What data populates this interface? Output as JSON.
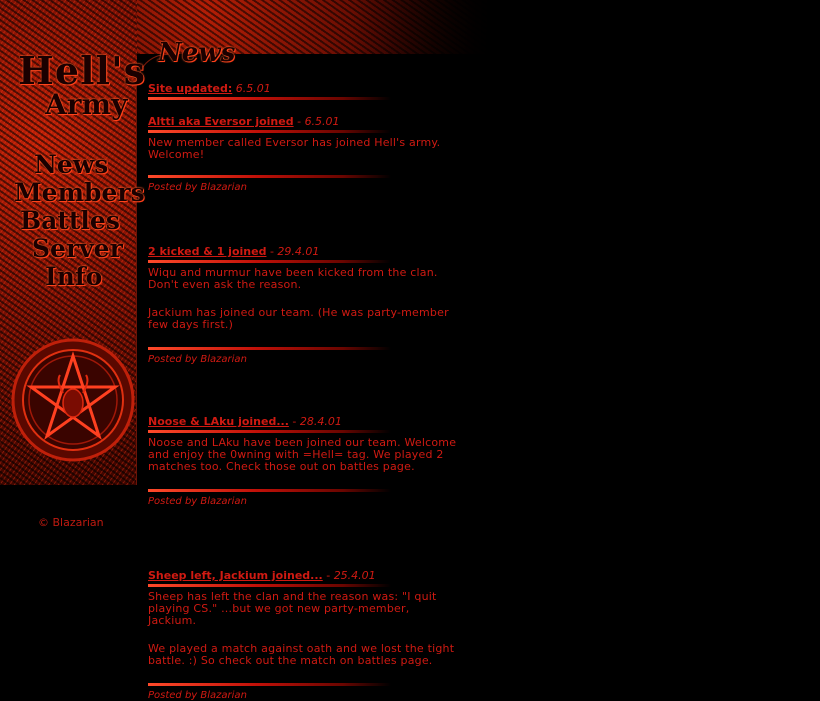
{
  "logo": {
    "line1": "Hell's",
    "line2": "Army"
  },
  "nav": {
    "news": "News",
    "members": "Members",
    "battles": "Battles",
    "server": "Server",
    "info": "Info"
  },
  "section_title": "News",
  "copyright": "© Blazarian",
  "posts": [
    {
      "title": "Site updated:",
      "date": "6.5.01",
      "paragraphs": [],
      "posted_by": ""
    },
    {
      "title": "Altti aka Eversor joined",
      "date": "6.5.01",
      "paragraphs": [
        "New member called Eversor has joined Hell's army. Welcome!"
      ],
      "posted_by": "Posted by Blazarian"
    },
    {
      "title": "2 kicked & 1 joined",
      "date": "29.4.01",
      "paragraphs": [
        "Wiqu and murmur have been kicked from the clan. Don't even ask the reason.",
        "Jackium has joined our team. (He was party-member few days first.)"
      ],
      "posted_by": "Posted by Blazarian"
    },
    {
      "title": "Noose & LAku joined...",
      "date": "28.4.01",
      "paragraphs": [
        "Noose and LAku have been joined our team. Welcome and enjoy the 0wning with =Hell= tag. We played 2 matches too. Check those out on battles page."
      ],
      "posted_by": "Posted by Blazarian"
    },
    {
      "title": "Sheep left, Jackium joined...",
      "date": "25.4.01",
      "paragraphs": [
        "Sheep has left the clan and the reason was: \"I quit playing CS.\" ...but we got new party-member, Jackium.",
        "We played a match against oath and we lost the tight battle. :) So check out the match on battles page."
      ],
      "posted_by": "Posted by Blazarian"
    }
  ],
  "colors": {
    "accent": "#d01a12",
    "background": "#000000"
  },
  "icons": {
    "emblem": "pentagram-goat-emblem"
  }
}
